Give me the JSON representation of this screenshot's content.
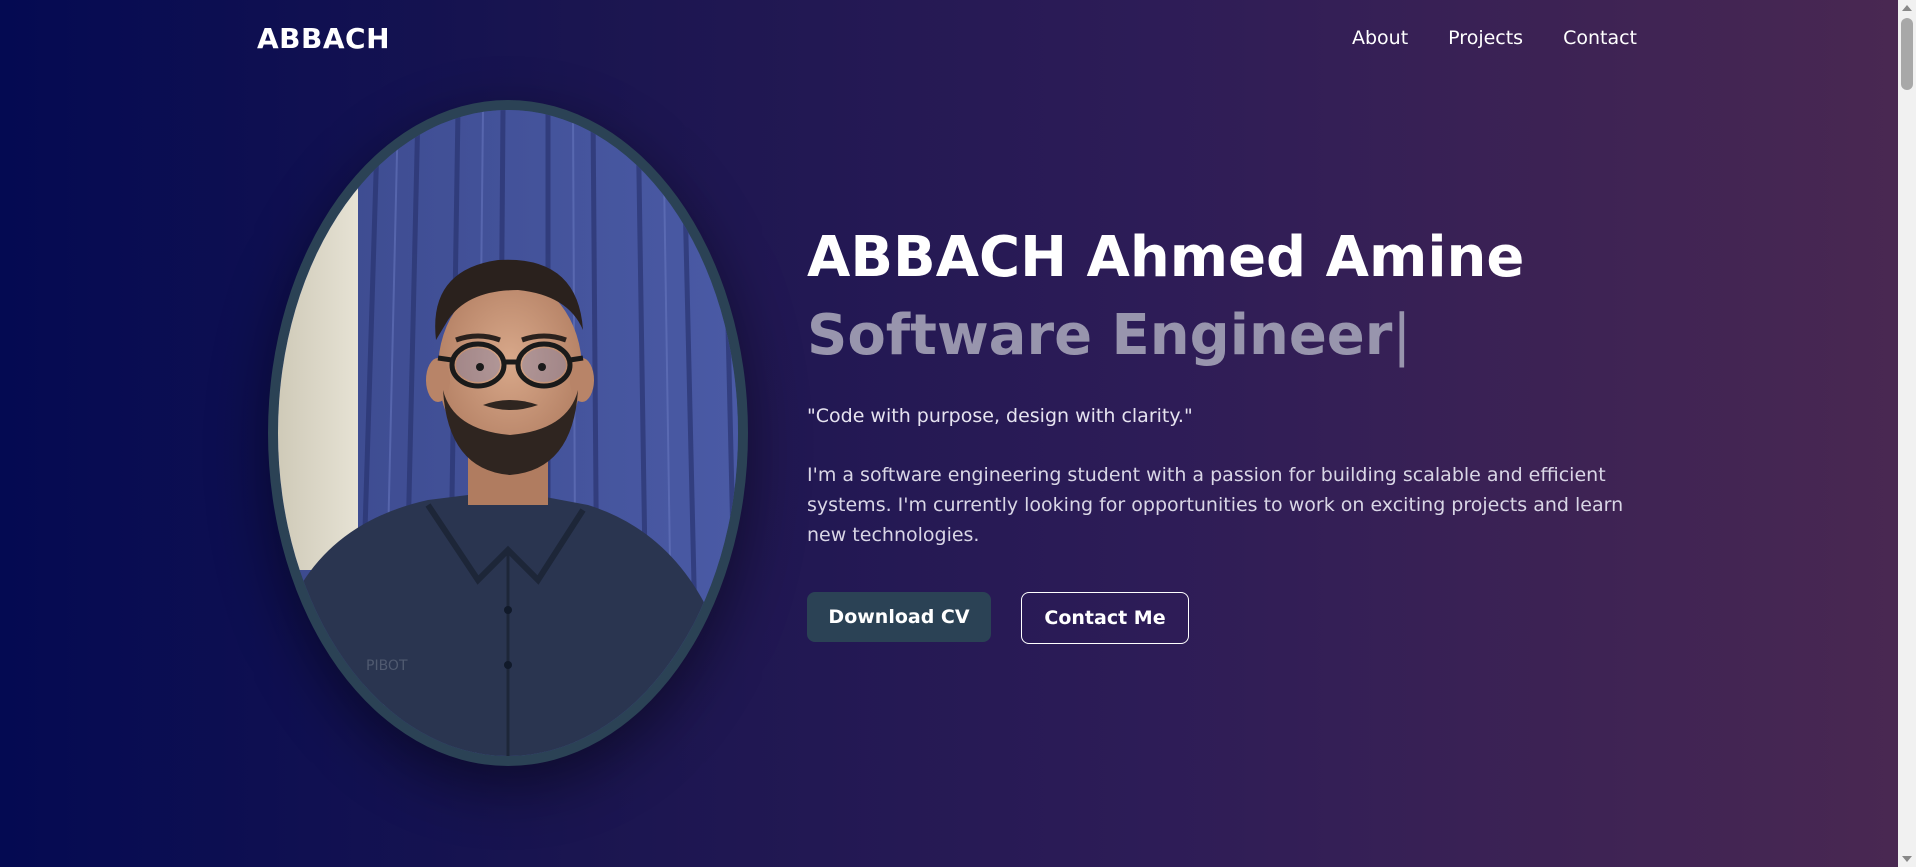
{
  "nav": {
    "brand": "ABBACH",
    "links": [
      "About",
      "Projects",
      "Contact"
    ]
  },
  "hero": {
    "name": "ABBACH Ahmed Amine",
    "role": "Software Engineer",
    "cursor": "|",
    "quote": "\"Code with purpose, design with clarity.\"",
    "bio": "I'm a software engineering student with a passion for building scalable and efficient systems. I'm currently looking for opportunities to work on exciting projects and learn new technologies.",
    "buttons": {
      "primary": "Download CV",
      "secondary": "Contact Me"
    }
  },
  "portrait": {
    "shirt_logo_text": "PIBOT"
  },
  "colors": {
    "gradient_start": "#040a52",
    "gradient_end": "#4a2852",
    "accent": "#2b4255",
    "role_text": "#9895ad"
  }
}
